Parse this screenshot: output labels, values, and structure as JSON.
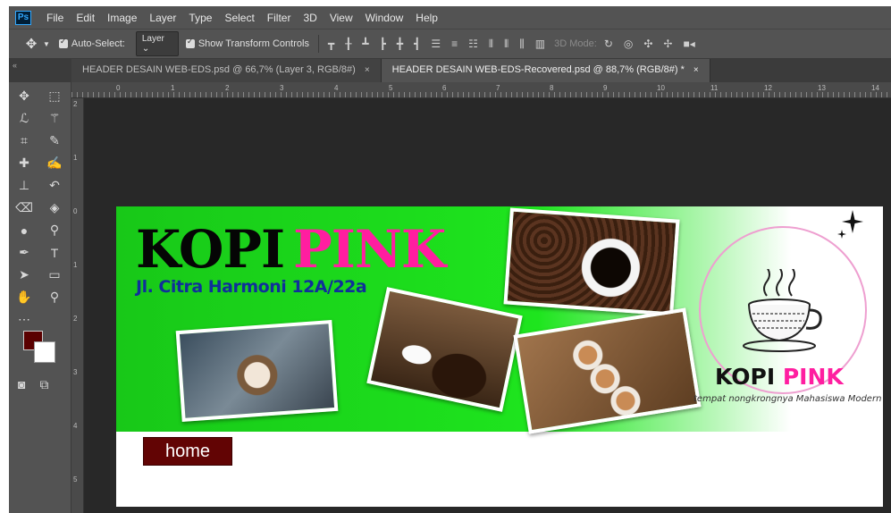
{
  "app": {
    "logo": "Ps"
  },
  "menu": [
    "File",
    "Edit",
    "Image",
    "Layer",
    "Type",
    "Select",
    "Filter",
    "3D",
    "View",
    "Window",
    "Help"
  ],
  "options": {
    "auto_select_label": "Auto-Select:",
    "auto_select_checked": true,
    "layer_dropdown": "Layer",
    "show_transform_label": "Show Transform Controls",
    "show_transform_checked": true,
    "mode_3d_label": "3D Mode:"
  },
  "tabs": [
    {
      "label": "HEADER DESAIN WEB-EDS.psd @ 66,7% (Layer 3, RGB/8#)",
      "close": "×",
      "active": false
    },
    {
      "label": "HEADER DESAIN WEB-EDS-Recovered.psd @ 88,7% (RGB/8#) *",
      "close": "×",
      "active": true
    }
  ],
  "ruler": {
    "top_ticks": [
      "0",
      "1",
      "2",
      "3",
      "4",
      "5",
      "6",
      "7",
      "8",
      "9",
      "10",
      "11",
      "12",
      "13",
      "14"
    ],
    "left_ticks": [
      "2",
      "1",
      "0",
      "1",
      "2",
      "3",
      "4",
      "5"
    ]
  },
  "colors": {
    "foreground": "#5a0000",
    "background": "#ffffff",
    "banner_green": "#1ee51e",
    "pink": "#ff1ea0",
    "address_blue": "#102f9a",
    "home_button": "#620404"
  },
  "canvas": {
    "title_part1": "KOPI",
    "title_part2": "PINK",
    "address": "Jl. Citra Harmoni 12A/22a",
    "logo_title_part1": "KOPI",
    "logo_title_part2": "PINK",
    "tagline": "tempat nongkrongnya Mahasiswa Modern",
    "home_button": "home"
  }
}
